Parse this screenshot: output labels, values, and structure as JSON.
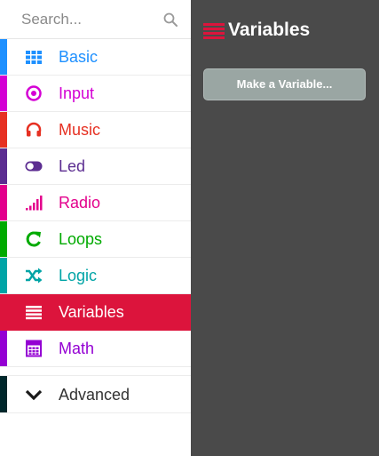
{
  "search": {
    "placeholder": "Search..."
  },
  "categories": [
    {
      "id": "basic",
      "label": "Basic",
      "color": "#1e90ff",
      "icon": "grid-icon"
    },
    {
      "id": "input",
      "label": "Input",
      "color": "#d400d4",
      "icon": "target-icon"
    },
    {
      "id": "music",
      "label": "Music",
      "color": "#e63022",
      "icon": "headphones-icon"
    },
    {
      "id": "led",
      "label": "Led",
      "color": "#5c2d91",
      "icon": "toggle-icon"
    },
    {
      "id": "radio",
      "label": "Radio",
      "color": "#e3008c",
      "icon": "signal-bars-icon"
    },
    {
      "id": "loops",
      "label": "Loops",
      "color": "#00aa00",
      "icon": "loop-arrow-icon"
    },
    {
      "id": "logic",
      "label": "Logic",
      "color": "#00a4a6",
      "icon": "shuffle-icon"
    },
    {
      "id": "variables",
      "label": "Variables",
      "color": "#dc143c",
      "icon": "list-lines-icon",
      "selected": true
    },
    {
      "id": "math",
      "label": "Math",
      "color": "#9400d3",
      "icon": "calculator-icon"
    }
  ],
  "advanced": {
    "label": "Advanced",
    "color": "#00272b",
    "icon": "chevron-down-icon"
  },
  "flyout": {
    "title": "Variables",
    "icon": "list-lines-icon",
    "color": "#dc143c",
    "make_variable_label": "Make a Variable..."
  }
}
